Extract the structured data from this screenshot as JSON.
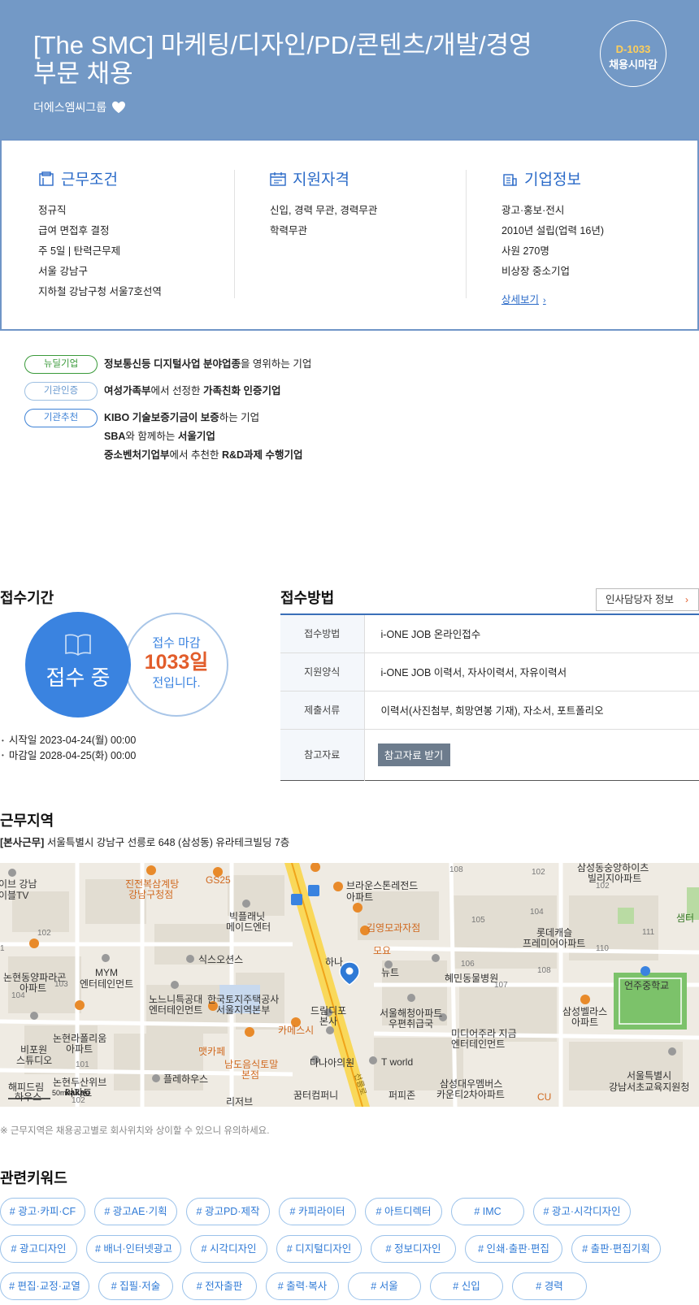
{
  "header": {
    "title": "[The SMC] 마케팅/디자인/PD/콘텐츠/개발/경영 부문 채용",
    "company": "더에스엠씨그룹",
    "dday": "D-1033",
    "dday_status": "채용시마감"
  },
  "summary": {
    "work": {
      "title": "근무조건",
      "items": [
        "정규직",
        "급여 면접후 결정",
        "주 5일 | 탄력근무제",
        "서울 강남구",
        "지하철 강남구청 서울7호선역"
      ]
    },
    "qual": {
      "title": "지원자격",
      "items": [
        "신입, 경력 무관, 경력무관",
        "학력무관"
      ]
    },
    "corp": {
      "title": "기업정보",
      "items": [
        "광고·홍보·전시",
        "2010년 설립(업력 16년)",
        "사원 270명",
        "비상장 중소기업"
      ],
      "more": "상세보기"
    }
  },
  "badges": [
    {
      "label": "뉴딜기업",
      "style": "green",
      "lines": [
        [
          "정보통신등 디지털사업 분야업종",
          "을 영위하는 기업"
        ]
      ]
    },
    {
      "label": "기관인증",
      "style": "lblue",
      "lines": [
        [
          "여성가족부",
          "에서 선정한 ",
          "가족친화 인증기업"
        ]
      ]
    },
    {
      "label": "기관추천",
      "style": "blue",
      "lines": [
        [
          "KIBO 기술보증기금이 보증",
          "하는 기업"
        ],
        [
          "SBA",
          "와 함께하는 ",
          "서울기업"
        ],
        [
          "중소벤처기업부",
          "에서 추천한 ",
          "R&D과제 수행기업"
        ]
      ]
    }
  ],
  "period": {
    "title": "접수기간",
    "status": "접수 중",
    "remain_top": "접수 마감",
    "remain_days": "1033일",
    "remain_bottom": "전입니다.",
    "start": "시작일 2023-04-24(월) 00:00",
    "end": "마감일 2028-04-25(화) 00:00"
  },
  "method": {
    "title": "접수방법",
    "hr_button": "인사담당자 정보",
    "rows": [
      {
        "label": "접수방법",
        "value": "i-ONE JOB 온라인접수"
      },
      {
        "label": "지원양식",
        "value": "i-ONE JOB 이력서, 자사이력서, 자유이력서"
      },
      {
        "label": "제출서류",
        "value": "이력서(사진첨부, 희망연봉 기재), 자소서, 포트폴리오"
      },
      {
        "label": "참고자료",
        "button": "참고자료 받기"
      }
    ]
  },
  "location": {
    "title": "근무지역",
    "tag": "[본사근무]",
    "address": "서울특별시 강남구 선릉로 648 (삼성동) 유라테크빌딩 7층",
    "note": "※ 근무지역은 채용공고별로 회사위치와 상이할 수 있으니 유의하세요.",
    "map_labels": [
      "이브 강남",
      "이블TV",
      "진전복삼계탕",
      "강남구청점",
      "GS25",
      "빅플래닛",
      "메이드엔터",
      "브라운스톤레전드",
      "아파트",
      "김영모과자점",
      "모요",
      "하나",
      "뉴트",
      "혜민동물병원",
      "삼성동숭앙하이츠",
      "빌리지아파트",
      "롯데캐슬",
      "프레미어아파트",
      "샘터",
      "논현동양파라곤",
      "아파트",
      "MYM",
      "엔터테인먼트",
      "식스오션스",
      "노느니특공대",
      "엔터테인먼트",
      "한국토지주택공사",
      "서울지역본부",
      "드림디포",
      "본사",
      "서울해청아파트",
      "우편취급국",
      "미디어주라 지금",
      "엔터테인먼트",
      "삼성벨라스",
      "아파트",
      "언주중학교",
      "논현라폴리움",
      "아파트",
      "비포원",
      "스튜디오",
      "맷카페",
      "카메스시",
      "남도음식토말",
      "본점",
      "다나아의원",
      "T world",
      "플레하우스",
      "해피드림",
      "하우스",
      "논현두산위브",
      "아파트",
      "리저브",
      "꿈터컴퍼니",
      "퍼피존",
      "삼성대우멤버스",
      "카운티2차아파트",
      "CU",
      "서울특별시",
      "강남서초교육지원청",
      "선릉로",
      "kakao",
      "50m"
    ],
    "map_numbers": [
      "108",
      "102",
      "105",
      "104",
      "110",
      "111",
      "106",
      "108",
      "107",
      "102",
      "103",
      "104",
      "101",
      "102",
      "1",
      "102"
    ]
  },
  "keywords": {
    "title": "관련키워드",
    "rows": [
      [
        "# 광고·카피·CF",
        "# 광고AE·기획",
        "# 광고PD·제작",
        "# 카피라이터",
        "# 아트디렉터",
        "# IMC",
        "# 광고·시각디자인"
      ],
      [
        "# 광고디자인",
        "# 배너·인터넷광고",
        "# 시각디자인",
        "# 디지털디자인",
        "# 정보디자인",
        "# 인쇄·출판·편집",
        "# 출판·편집기획"
      ],
      [
        "# 편집·교정·교열",
        "# 집필·저술",
        "# 전자출판",
        "# 출력·복사",
        "# 서울",
        "# 신입",
        "# 경력"
      ]
    ]
  },
  "colors": {
    "header_bg": "#7399c6",
    "accent": "#2a6ac8",
    "dday": "#ffcf5a",
    "remain": "#e25d2b",
    "status_circle": "#3a83e0"
  }
}
